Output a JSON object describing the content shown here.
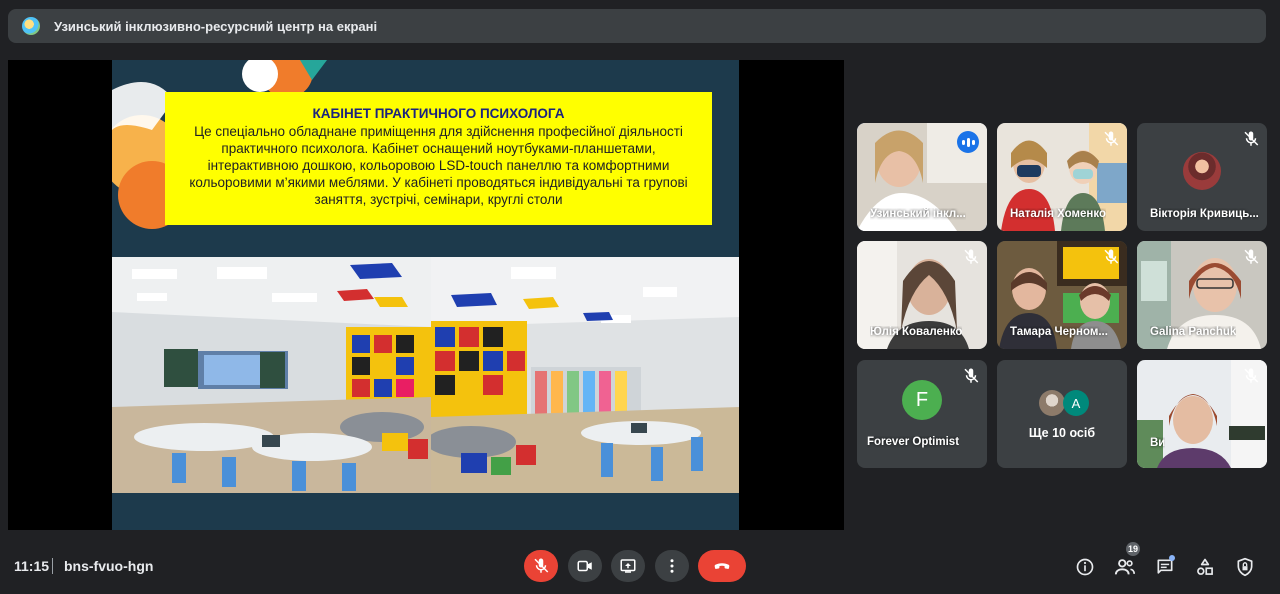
{
  "banner": {
    "text": "Узинський інклюзивно-ресурсний центр на екрані",
    "icon": "presenter-avatar-icon"
  },
  "slide": {
    "title": "КАБІНЕТ ПРАКТИЧНОГО ПСИХОЛОГА",
    "body": "Це спеціально обладнане приміщення для здійснення професійної діяльності практичного психолога. Кабінет оснащений ноутбуками-планшетами, інтерактивною дошкою, кольоровою LSD-touch панеллю та комфортними кольоровими м’якими меблями. У кабінеті проводяться індивідуальні та групові заняття, зустрічі, семінари, круглі столи",
    "colors": {
      "box": "#ffff00",
      "title": "#1a237e",
      "background": "#1d3a4c"
    }
  },
  "participants": [
    {
      "name": "Узинський інкл...",
      "status": "speaking"
    },
    {
      "name": "Наталія Хоменко",
      "status": "muted"
    },
    {
      "name": "Вікторія Кривиць...",
      "status": "muted"
    },
    {
      "name": "Юлія Коваленко",
      "status": "muted"
    },
    {
      "name": "Тамара Черном...",
      "status": "muted"
    },
    {
      "name": "Galina Panchuk",
      "status": "muted"
    },
    {
      "name": "Forever Optimist",
      "status": "muted",
      "avatar_letter": "F"
    },
    {
      "name": "Ще 10 осіб",
      "status": "none",
      "avatar_letter": "A"
    },
    {
      "name": "Ви",
      "status": "muted"
    }
  ],
  "bottom": {
    "time": "11:15",
    "meeting_code": "bns-fvuo-hgn",
    "controls": [
      "mic-off-icon",
      "camera-icon",
      "present-screen-icon",
      "more-options-icon",
      "end-call-icon"
    ],
    "participants_count": "19",
    "right_icons": [
      "info-icon",
      "people-icon",
      "chat-icon",
      "activities-icon",
      "host-controls-icon"
    ]
  },
  "colors": {
    "background": "#202124",
    "tile": "#3c4043",
    "accent": "#1a73e8",
    "end_call": "#ea4335"
  }
}
